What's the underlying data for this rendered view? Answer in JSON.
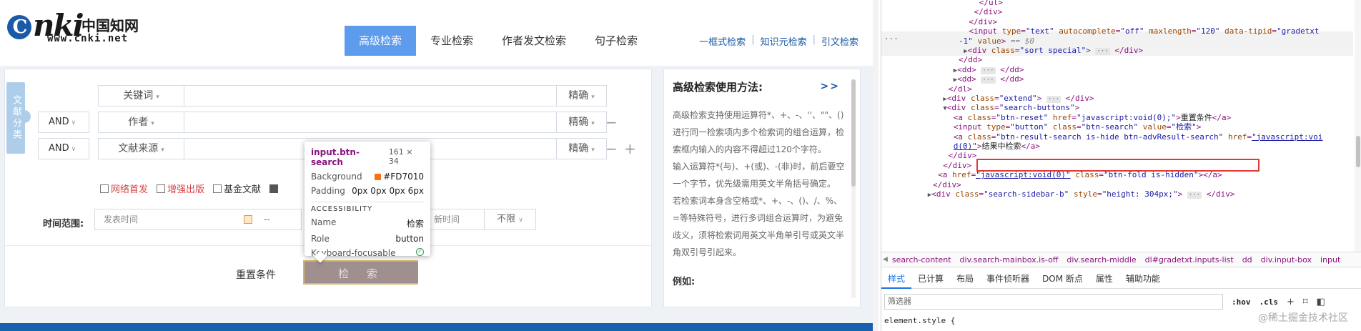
{
  "site": {
    "logo": {
      "mark": "nki",
      "cn": "中国知网",
      "url": "www.cnki.net"
    },
    "tabs": [
      {
        "label": "高级检索",
        "active": true
      },
      {
        "label": "专业检索",
        "active": false
      },
      {
        "label": "作者发文检索",
        "active": false
      },
      {
        "label": "句子检索",
        "active": false
      }
    ],
    "toplinks": [
      "一框式检索",
      "知识元检索",
      "引文检索"
    ],
    "side_tab": "文献分类",
    "rows": [
      {
        "logic": "",
        "field": "关键词",
        "match": "精确",
        "ops": []
      },
      {
        "logic": "AND",
        "field": "作者",
        "match": "精确",
        "ops": [
          "−"
        ]
      },
      {
        "logic": "AND",
        "field": "文献来源",
        "match": "精确",
        "ops": [
          "−",
          "+"
        ]
      }
    ],
    "checkboxes": [
      {
        "label": "网络首发",
        "style": "red"
      },
      {
        "label": "增强出版",
        "style": "red"
      },
      {
        "label": "基金文献",
        "style": "normal"
      }
    ],
    "time_label": "时间范围:",
    "date_placeholder": "发表时间",
    "date_dash": "--",
    "update_label": "新时间",
    "update_value": "不限",
    "reset_label": "重置条件",
    "search_label": "检 索",
    "help": {
      "title": "高级检索使用方法:",
      "more": ">>",
      "paragraphs": [
        "高级检索支持使用运算符*、+、-、''、\"\"、()进行同一检索项内多个检索词的组合运算，检索框内输入的内容不得超过120个字符。",
        "输入运算符*(与)、+(或)、-(非)时，前后要空一个字节，优先级需用英文半角括号确定。",
        "若检索词本身含空格或*、+、-、()、/、%、=等特殊符号，进行多词组合运算时，为避免歧义，须将检索词用英文半角单引号或英文半角双引号引起来。"
      ],
      "example": "例如:"
    },
    "tooltip": {
      "selector": "input.btn-search",
      "size": "161 × 34",
      "background_label": "Background",
      "background_value": "#FD7010",
      "padding_label": "Padding",
      "padding_value": "0px 0px 0px 6px",
      "accessibility": "ACCESSIBILITY",
      "name_label": "Name",
      "name_value": "检索",
      "role_label": "Role",
      "role_value": "button",
      "focus_label": "Keyboard-focusable"
    }
  },
  "devtools": {
    "dom_lines": [
      {
        "indent": 19,
        "html": "&lt;/ul&gt;"
      },
      {
        "indent": 18,
        "html": "&lt;/div&gt;"
      },
      {
        "indent": 17,
        "html": "&lt;/div&gt;"
      },
      {
        "indent": 17,
        "html": "&lt;input <span class=\"attr\">type</span>=<span class=\"val\">\"text\"</span> <span class=\"attr\">autocomplete</span>=<span class=\"val\">\"off\"</span> <span class=\"attr\">maxlength</span>=<span class=\"val\">\"120\"</span> <span class=\"attr\">data-tipid</span>=<span class=\"val\">\"gradetxt</span>"
      },
      {
        "indent": 15,
        "html": "<span class=\"val\">-1\"</span> <span class=\"attr\">value</span>&gt; <span class=\"dollar\">== $0</span>"
      },
      {
        "indent": 16,
        "html": "<span class=\"tri\">▶</span>&lt;div <span class=\"attr\">class</span>=<span class=\"val\">\"sort special\"</span>&gt; <span class=\"ell\">···</span> &lt;/div&gt;"
      },
      {
        "indent": 15,
        "html": "&lt;/dd&gt;"
      },
      {
        "indent": 14,
        "html": "<span class=\"tri\">▶</span>&lt;dd&gt; <span class=\"ell\">···</span> &lt;/dd&gt;"
      },
      {
        "indent": 14,
        "html": "<span class=\"tri\">▶</span>&lt;dd&gt; <span class=\"ell\">···</span> &lt;/dd&gt;"
      },
      {
        "indent": 13,
        "html": "&lt;/dl&gt;"
      },
      {
        "indent": 12,
        "html": "<span class=\"tri\">▶</span>&lt;div <span class=\"attr\">class</span>=<span class=\"val\">\"extend\"</span>&gt; <span class=\"ell\">···</span> &lt;/div&gt;"
      },
      {
        "indent": 12,
        "html": "<span class=\"tri\">▼</span>&lt;div <span class=\"attr\">class</span>=<span class=\"val\">\"search-buttons\"</span>&gt;"
      },
      {
        "indent": 14,
        "html": "&lt;a <span class=\"attr\">class</span>=<span class=\"val\">\"btn-reset\"</span> <span class=\"attr\">href</span>=<span class=\"val\">\"javascript:void(0);\"</span>&gt;<span class=\"txt\">重置条件</span>&lt;/a&gt;"
      },
      {
        "indent": 14,
        "html": "&lt;input <span class=\"attr\">type</span>=<span class=\"val\">\"button\"</span> <span class=\"attr\">class</span>=<span class=\"val\">\"btn-search\"</span> <span class=\"attr\">value</span>=<span class=\"val\">\"检索\"</span>&gt;"
      },
      {
        "indent": 14,
        "html": "&lt;a <span class=\"attr\">class</span>=<span class=\"val\">\"btn-result-search is-hide btn-advResult-search\"</span> <span class=\"attr\">href</span>=<span class=\"lnk\">\"javascript:voi</span>"
      },
      {
        "indent": 14,
        "html": "<span class=\"lnk\">d(0)\"</span>&gt;<span class=\"txt\">结果中检索</span>&lt;/a&gt;"
      },
      {
        "indent": 13,
        "html": "&lt;/div&gt;"
      },
      {
        "indent": 12,
        "html": "&lt;/div&gt;"
      },
      {
        "indent": 11,
        "html": "&lt;a <span class=\"attr\">href</span>=<span class=\"lnk\">\"javascript:void(0)\"</span> <span class=\"attr\">class</span>=<span class=\"val\">\"btn-fold is-hidden\"</span>&gt;&lt;/a&gt;"
      },
      {
        "indent": 10,
        "html": "&lt;/div&gt;"
      },
      {
        "indent": 9,
        "html": "<span class=\"tri\">▶</span>&lt;div <span class=\"attr\">class</span>=<span class=\"val\">\"search-sidebar-b\"</span> <span class=\"attr\">style</span>=<span class=\"val\">\"height: 304px;\"</span>&gt; <span class=\"ell\">···</span> &lt;/div&gt;"
      }
    ],
    "breadcrumbs": [
      "search-content",
      "div.search-mainbox.is-off",
      "div.search-middle",
      "dl#gradetxt.inputs-list",
      "dd",
      "div.input-box",
      "input"
    ],
    "subtabs": [
      "样式",
      "已计算",
      "布局",
      "事件侦听器",
      "DOM 断点",
      "属性",
      "辅助功能"
    ],
    "filter_placeholder": "筛选器",
    "hov": ":hov",
    "cls": ".cls",
    "element_style": "element.style {",
    "watermark": "@稀土掘金技术社区"
  }
}
